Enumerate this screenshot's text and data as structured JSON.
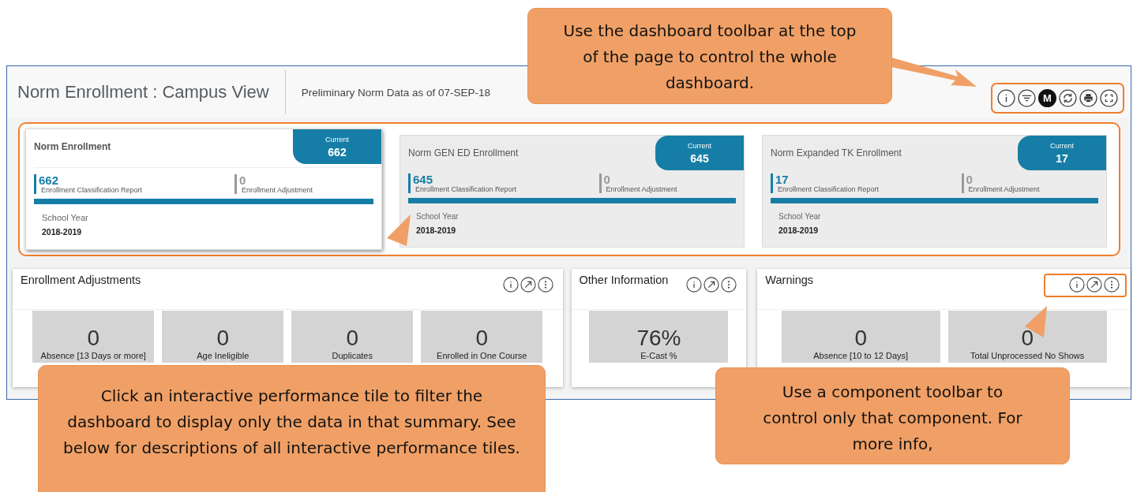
{
  "header": {
    "title": "Norm Enrollment : Campus View",
    "subtitle": "Preliminary Norm Data as of 07-SEP-18",
    "toolbar_highlighted": true,
    "toolbar": [
      {
        "kind": "info"
      },
      {
        "kind": "filter"
      },
      {
        "kind": "letter",
        "label": "M"
      },
      {
        "kind": "refresh"
      },
      {
        "kind": "print"
      },
      {
        "kind": "fullscreen"
      }
    ]
  },
  "tiles_highlighted": true,
  "tiles": [
    {
      "title": "Norm Enrollment",
      "selected": true,
      "current_label": "Current",
      "current_value": "662",
      "report_value": "662",
      "report_label": "Enrollment Classification Report",
      "adjustment_value": "0",
      "adjustment_label": "Enrollment Adjustment",
      "year_label": "School Year",
      "year_value": "2018-2019"
    },
    {
      "title": "Norm GEN ED Enrollment",
      "selected": false,
      "current_label": "Current",
      "current_value": "645",
      "report_value": "645",
      "report_label": "Enrollment Classification Report",
      "adjustment_value": "0",
      "adjustment_label": "Enrollment Adjustment",
      "year_label": "School Year",
      "year_value": "2018-2019"
    },
    {
      "title": "Norm Expanded TK Enrollment",
      "selected": false,
      "current_label": "Current",
      "current_value": "17",
      "report_value": "17",
      "report_label": "Enrollment Classification Report",
      "adjustment_value": "0",
      "adjustment_label": "Enrollment Adjustment",
      "year_label": "School Year",
      "year_value": "2018-2019"
    }
  ],
  "panels": [
    {
      "title": "Enrollment Adjustments",
      "toolbar_highlighted": false,
      "tiles": [
        {
          "value": "0",
          "label": "Absence [13 Days or more]"
        },
        {
          "value": "0",
          "label": "Age Ineligible"
        },
        {
          "value": "0",
          "label": "Duplicates"
        },
        {
          "value": "0",
          "label": "Enrolled in One Course"
        }
      ]
    },
    {
      "title": "Other Information",
      "toolbar_highlighted": false,
      "tiles": [
        {
          "value": "76%",
          "label": "E-Cast %"
        }
      ]
    },
    {
      "title": "Warnings",
      "toolbar_highlighted": true,
      "tiles": [
        {
          "value": "0",
          "label": "Absence [10 to 12 Days]"
        },
        {
          "value": "0",
          "label": "Total Unprocessed No Shows"
        }
      ]
    }
  ],
  "callouts": [
    {
      "text": "Use the dashboard toolbar at the top of the page to control the whole dashboard."
    },
    {
      "text": "Click an interactive performance tile to filter the dashboard to display only the data in that summary. See below for descriptions of all interactive performance tiles."
    },
    {
      "text": "Use a component toolbar to control only that component. For more info,"
    }
  ]
}
